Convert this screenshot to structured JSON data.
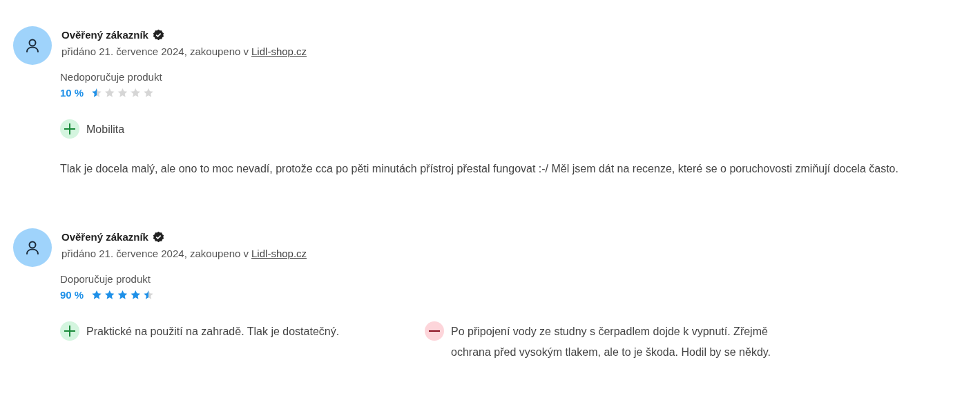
{
  "reviews": [
    {
      "author": "Ověřený zákazník",
      "verified": true,
      "meta": "přidáno 21. července 2024, zakoupeno v",
      "shop": "Lidl-shop.cz",
      "recommendation": "Nedoporučuje produkt",
      "percent": "10 %",
      "stars": 0.5,
      "points": [
        {
          "kind": "pro",
          "text": "Mobilita"
        }
      ],
      "body": "Tlak je docela malý, ale ono to moc nevadí, protože cca po pěti minutách přístroj přestal fungovat :-/ Měl jsem dát na recenze, které se o poruchovosti zmiňují docela často."
    },
    {
      "author": "Ověřený zákazník",
      "verified": true,
      "meta": "přidáno 21. července 2024, zakoupeno v",
      "shop": "Lidl-shop.cz",
      "recommendation": "Doporučuje produkt",
      "percent": "90 %",
      "stars": 4.5,
      "points": [
        {
          "kind": "pro",
          "text": "Praktické na použití na zahradě. Tlak je dostatečný."
        },
        {
          "kind": "con",
          "text": "Po připojení vody ze studny s čerpadlem dojde k vypnutí. Zřejmě ochrana před vysokým tlakem, ale to je škoda. Hodil by se někdy."
        }
      ]
    }
  ]
}
